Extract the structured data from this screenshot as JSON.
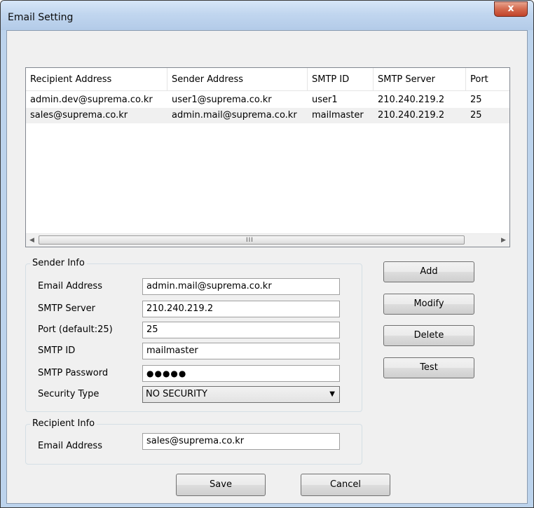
{
  "window": {
    "title": "Email Setting",
    "close_glyph": "x"
  },
  "list": {
    "columns": [
      "Recipient Address",
      "Sender Address",
      "SMTP ID",
      "SMTP Server",
      "Port"
    ],
    "rows": [
      [
        "admin.dev@suprema.co.kr",
        "user1@suprema.co.kr",
        "user1",
        "210.240.219.2",
        "25"
      ],
      [
        "sales@suprema.co.kr",
        "admin.mail@suprema.co.kr",
        "mailmaster",
        "210.240.219.2",
        "25"
      ]
    ],
    "scroll_left_icon": "scroll-left-icon",
    "scroll_right_icon": "scroll-right-icon",
    "scroll_grip": "III"
  },
  "sender_info": {
    "legend": "Sender Info",
    "email_label": "Email Address",
    "email_value": "admin.mail@suprema.co.kr",
    "smtp_server_label": "SMTP Server",
    "smtp_server_value": "210.240.219.2",
    "port_label": "Port (default:25)",
    "port_value": "25",
    "smtp_id_label": "SMTP ID",
    "smtp_id_value": "mailmaster",
    "smtp_password_label": "SMTP Password",
    "smtp_password_masked": "●●●●●",
    "security_label": "Security Type",
    "security_value": "NO SECURITY"
  },
  "recipient_info": {
    "legend": "Recipient Info",
    "email_label": "Email Address",
    "email_value": "sales@suprema.co.kr"
  },
  "buttons": {
    "add": "Add",
    "modify": "Modify",
    "delete": "Delete",
    "test": "Test",
    "save": "Save",
    "cancel": "Cancel"
  },
  "colors": {
    "titlebar": "#c1d6ef",
    "close_button": "#c0432a",
    "dialog_background": "#f0f0f0",
    "selected_row": "#f0f0f0"
  }
}
